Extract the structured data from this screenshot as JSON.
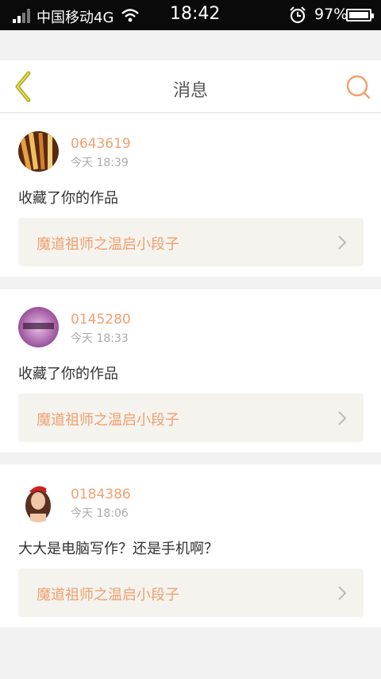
{
  "status_bar": {
    "carrier": "中国移动4G",
    "time": "18:42",
    "battery": "97%"
  },
  "header": {
    "title": "消息",
    "back_icon": "back-chevron-icon",
    "search_icon": "search-icon"
  },
  "colors": {
    "accent": "#f0a070",
    "back_icon": "#b8b020",
    "background": "#f2f2f2"
  },
  "messages": [
    {
      "user_id": "0643619",
      "time": "今天 18:39",
      "text": "收藏了你的作品",
      "work_title": "魔道祖师之温启小段子"
    },
    {
      "user_id": "0145280",
      "time": "今天 18:33",
      "text": "收藏了你的作品",
      "work_title": "魔道祖师之温启小段子"
    },
    {
      "user_id": "0184386",
      "time": "今天 18:06",
      "text": "大大是电脑写作？还是手机啊？",
      "work_title": "魔道祖师之温启小段子"
    }
  ]
}
